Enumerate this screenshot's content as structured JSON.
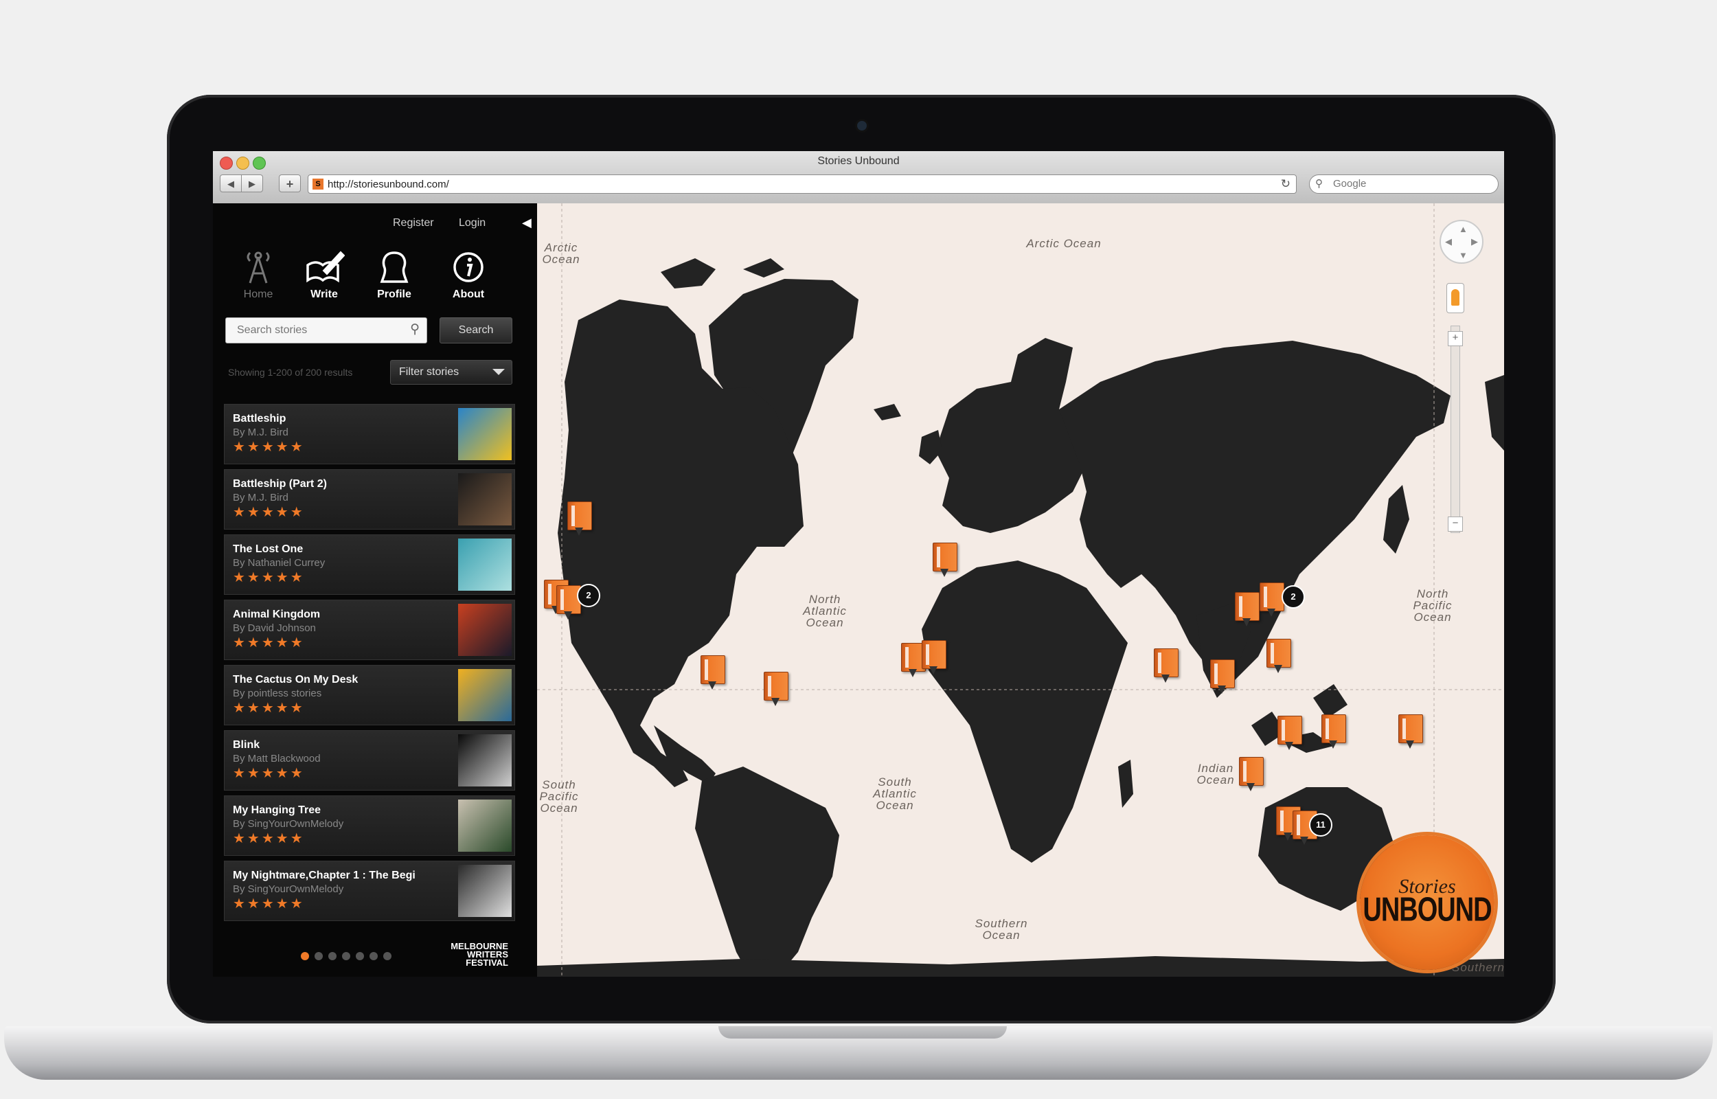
{
  "browser": {
    "window_title": "Stories Unbound",
    "url": "http://storiesunbound.com/",
    "search_placeholder": "Google",
    "back_label": "◀",
    "forward_label": "▶",
    "add_label": "+",
    "reload_label": "↻"
  },
  "sidebar": {
    "register": "Register",
    "login": "Login",
    "collapse": "◀",
    "nav": [
      {
        "label": "Home",
        "icon": "antenna-icon",
        "active": false
      },
      {
        "label": "Write",
        "icon": "write-icon",
        "active": true
      },
      {
        "label": "Profile",
        "icon": "profile-icon",
        "active": true
      },
      {
        "label": "About",
        "icon": "info-icon",
        "active": true
      }
    ],
    "search_placeholder": "Search stories",
    "search_button": "Search",
    "showing": "Showing 1-200 of 200 results",
    "filter_label": "Filter stories",
    "stories": [
      {
        "title": "Battleship",
        "author": "By M.J. Bird",
        "stars": "★★★★★",
        "thumb_colors": [
          "#2a84c8",
          "#f0c020"
        ]
      },
      {
        "title": "Battleship (Part 2)",
        "author": "By M.J. Bird",
        "stars": "★★★★★",
        "thumb_colors": [
          "#1a1a1a",
          "#7a5a40"
        ]
      },
      {
        "title": "The Lost One",
        "author": "By Nathaniel Currey",
        "stars": "★★★★★",
        "thumb_colors": [
          "#3aa0b0",
          "#aee0e0"
        ]
      },
      {
        "title": "Animal Kingdom",
        "author": "By David Johnson",
        "stars": "★★★★★",
        "thumb_colors": [
          "#c84020",
          "#1a1a2a"
        ]
      },
      {
        "title": "The Cactus On My Desk",
        "author": "By pointless stories",
        "stars": "★★★★★",
        "thumb_colors": [
          "#f0b020",
          "#2a6a9a"
        ]
      },
      {
        "title": "Blink",
        "author": "By Matt Blackwood",
        "stars": "★★★★★",
        "thumb_colors": [
          "#0a0a0a",
          "#d0d0d0"
        ]
      },
      {
        "title": "My Hanging Tree",
        "author": "By SingYourOwnMelody",
        "stars": "★★★★★",
        "thumb_colors": [
          "#c8c0b0",
          "#2a4a2a"
        ]
      },
      {
        "title": "My Nightmare,Chapter 1 : The Begi",
        "author": "By SingYourOwnMelody",
        "stars": "★★★★★",
        "thumb_colors": [
          "#2a2a2a",
          "#e0e0e0"
        ]
      }
    ],
    "pagination": {
      "pages": 7,
      "current": 1
    },
    "footer_logo": "MELBOURNE WRITERS FESTIVAL"
  },
  "map": {
    "oceans": {
      "arctic": "Arctic Ocean",
      "arctic_left": "Arctic Ocean",
      "north_atlantic": "North Atlantic Ocean",
      "north_pacific": "North Pacific Ocean",
      "south_atlantic": "South Atlantic Ocean",
      "indian": "Indian Ocean",
      "south_pacific": "South Pacific Ocean",
      "southern": "Southern Ocean",
      "southern_right": "Southern"
    },
    "clusters": [
      "2",
      "2",
      "11"
    ],
    "zoom_in": "+",
    "zoom_out": "−",
    "logo_line1": "Stories",
    "logo_line2": "UNBOUND",
    "colors": {
      "land": "#232323",
      "sea": "#f4ebe5",
      "pin": "#f07a2a"
    }
  }
}
